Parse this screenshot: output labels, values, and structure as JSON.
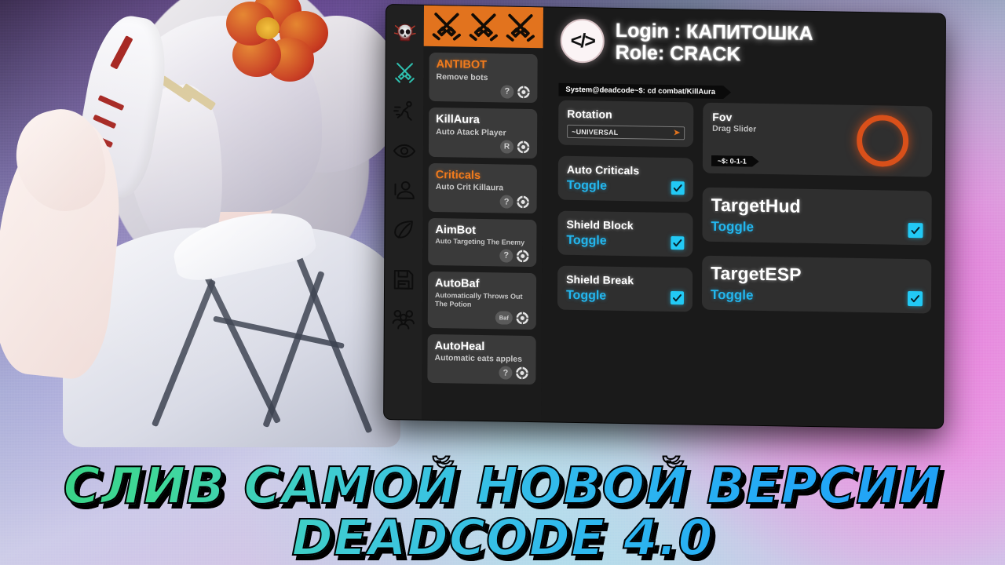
{
  "window": {
    "header": {
      "logo_icon": "code-brackets-icon",
      "login_line": "Login : КАПИТОШКА",
      "role_line": "Role: CRACK",
      "terminal_path": "System@deadcode~$: cd combat/KillAura"
    },
    "rail": [
      {
        "name": "skull-icon",
        "label": "Exploit"
      },
      {
        "name": "crossed-swords-icon",
        "label": "Combat",
        "active": true
      },
      {
        "name": "running-person-icon",
        "label": "Movement"
      },
      {
        "name": "eye-icon",
        "label": "Render"
      },
      {
        "name": "player-icon",
        "label": "Player"
      },
      {
        "name": "leaf-icon",
        "label": "World"
      },
      {
        "name": "floppy-disk-icon",
        "label": "Config"
      },
      {
        "name": "friends-icon",
        "label": "Friends"
      }
    ],
    "category_banner": {
      "icon": "crossed-swords-icon",
      "count": 3
    },
    "modules": [
      {
        "title": "ANTIBOT",
        "desc": "Remove bots",
        "accent": "orange",
        "badge": "?",
        "gear": true
      },
      {
        "title": "KillAura",
        "desc": "Auto Atack Player",
        "accent": "white",
        "badge": "R",
        "gear": true
      },
      {
        "title": "Criticals",
        "desc": "Auto Crit Killaura",
        "accent": "orange",
        "badge": "?",
        "gear": true
      },
      {
        "title": "AimBot",
        "desc": "Auto Targeting The Enemy",
        "accent": "white",
        "badge": "?",
        "gear": true
      },
      {
        "title": "AutoBaf",
        "desc": "Automatically Throws Out The Potion",
        "accent": "white",
        "badge": "Baf",
        "gear": true
      },
      {
        "title": "AutoHeal",
        "desc": "Automatic eats apples",
        "accent": "white",
        "badge": "?",
        "gear": true
      }
    ],
    "settings": {
      "rotation": {
        "title": "Rotation",
        "value": "~UNIVERSAL",
        "arrow": "chevron-right-icon"
      },
      "auto_criticals": {
        "title": "Auto Criticals",
        "toggle_label": "Toggle",
        "checked": true
      },
      "shield_block": {
        "title": "Shield Block",
        "toggle_label": "Toggle",
        "checked": true
      },
      "shield_break": {
        "title": "Shield Break",
        "toggle_label": "Toggle",
        "checked": true
      },
      "fov": {
        "title": "Fov",
        "subtitle": "Drag Slider",
        "tag": "~$: 0-1-1"
      },
      "target_hud": {
        "title": "TargetHud",
        "toggle_label": "Toggle",
        "checked": true
      },
      "target_esp": {
        "title": "TargetESP",
        "toggle_label": "Toggle",
        "checked": true
      }
    }
  },
  "overlay": {
    "headline_line1": "СЛИВ САМОЙ НОВОЙ ВЕРСИИ",
    "headline_line2": "DEADCODE 4.0"
  },
  "colors": {
    "accent_orange": "#e2731e",
    "toggle_cyan": "#23b7ef",
    "checkbox_cyan": "#22c9f5",
    "fov_ring": "#d9501a",
    "panel_bg": "#2f2f2f",
    "card_bg": "#3a3a3a",
    "window_bg": "#181818"
  }
}
